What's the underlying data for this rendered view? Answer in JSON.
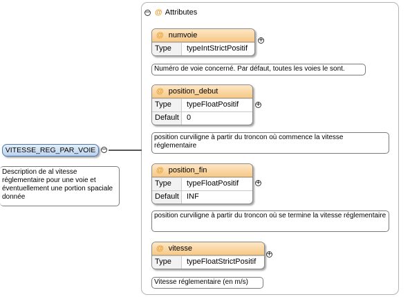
{
  "element": {
    "name": "VITESSE_REG_PAR_VOIE",
    "description": "Description de al vitesse réglementaire pour une voie et éventuellement une portion spaciale donnée"
  },
  "attributes_panel": {
    "title": "Attributes",
    "at_symbol": "@"
  },
  "attributes": [
    {
      "name": "numvoie",
      "rows": [
        {
          "label": "Type",
          "value": "typeIntStrictPositif"
        }
      ],
      "description": "Numéro de voie concerné. Par défaut, toutes les voies le sont."
    },
    {
      "name": "position_debut",
      "rows": [
        {
          "label": "Type",
          "value": "typeFloatPositif"
        },
        {
          "label": "Default",
          "value": "0"
        }
      ],
      "description": "position curviligne à partir du troncon où commence la vitesse réglementaire"
    },
    {
      "name": "position_fin",
      "rows": [
        {
          "label": "Type",
          "value": "typeFloatPositif"
        },
        {
          "label": "Default",
          "value": "INF"
        }
      ],
      "description": "position curviligne à partir du troncon où se termine la vitesse réglementaire"
    },
    {
      "name": "vitesse",
      "rows": [
        {
          "label": "Type",
          "value": "typeFloatStrictPositif"
        }
      ],
      "description": "Vitesse réglementaire (en m/s)"
    }
  ],
  "symbols": {
    "collapse": "−",
    "expand": "+"
  },
  "colors": {
    "attribute_header": "#f7c987",
    "element_fill": "#bcd3ee",
    "at_symbol": "#e89a2a"
  }
}
